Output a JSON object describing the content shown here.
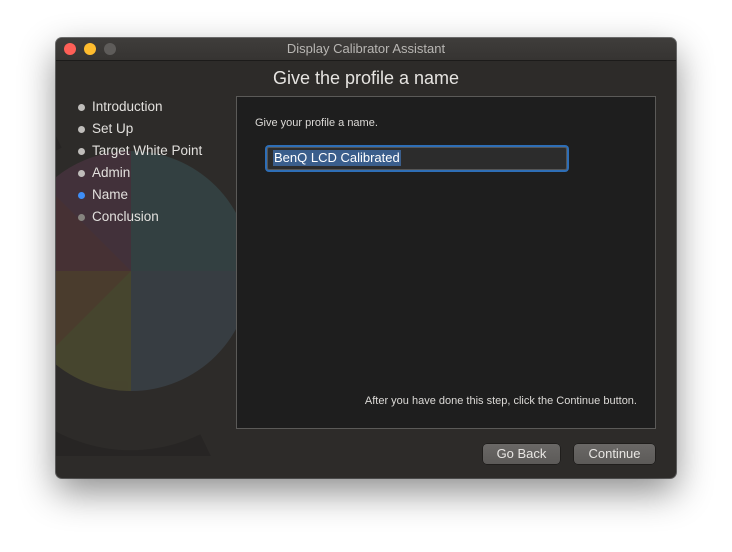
{
  "window": {
    "title": "Display Calibrator Assistant"
  },
  "heading": "Give the profile a name",
  "steps": [
    {
      "label": "Introduction",
      "state": "done"
    },
    {
      "label": "Set Up",
      "state": "done"
    },
    {
      "label": "Target White Point",
      "state": "done"
    },
    {
      "label": "Admin",
      "state": "done"
    },
    {
      "label": "Name",
      "state": "current"
    },
    {
      "label": "Conclusion",
      "state": "future"
    }
  ],
  "panel": {
    "prompt": "Give your profile a name.",
    "profile_name": "BenQ LCD Calibrated",
    "hint": "After you have done this step, click the Continue button."
  },
  "buttons": {
    "back": "Go Back",
    "continue": "Continue"
  },
  "colors": {
    "accent": "#3e8ef7",
    "close": "#fe5f57",
    "minimize": "#febc2e"
  }
}
